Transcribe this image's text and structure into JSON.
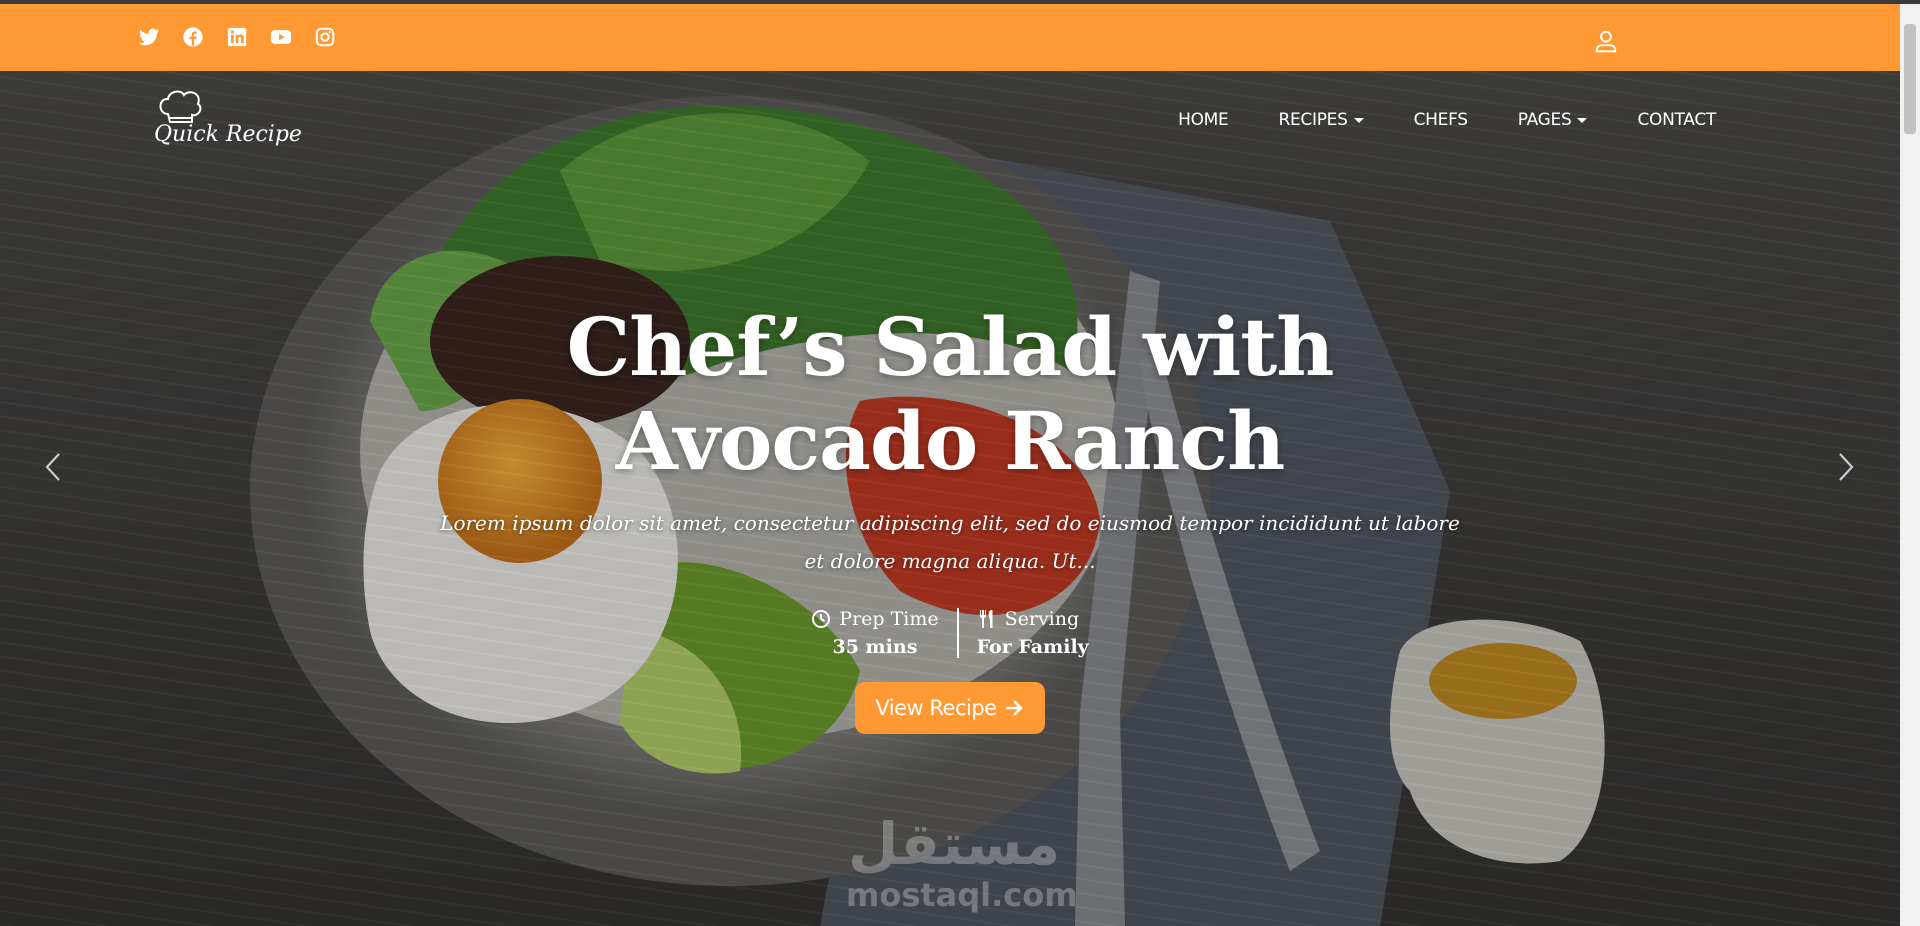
{
  "colors": {
    "accent": "#ff9933",
    "text_on_hero": "#ffffff"
  },
  "topbar": {
    "social_icons": [
      "twitter-icon",
      "facebook-icon",
      "linkedin-icon",
      "youtube-icon",
      "instagram-icon"
    ],
    "account_icon": "user-icon"
  },
  "logo": {
    "text": "Quick Recipe",
    "icon": "chef-hat-icon"
  },
  "nav": {
    "items": [
      {
        "label": "HOME",
        "dropdown": false
      },
      {
        "label": "RECIPES",
        "dropdown": true
      },
      {
        "label": "CHEFS",
        "dropdown": false
      },
      {
        "label": "PAGES",
        "dropdown": true
      },
      {
        "label": "CONTACT",
        "dropdown": false
      }
    ]
  },
  "hero": {
    "title_line1": "Chef’s Salad with",
    "title_line2": "Avocado Ranch",
    "description": "Lorem ipsum dolor sit amet, consectetur adipiscing elit, sed do eiusmod tempor incididunt ut labore et dolore magna aliqua. Ut...",
    "prep_label": "Prep Time",
    "prep_value": "35 mins",
    "serving_label": "Serving",
    "serving_value": "For Family",
    "button_label": "View Recipe",
    "prev_icon": "chevron-left-icon",
    "next_icon": "chevron-right-icon"
  },
  "watermark": {
    "arabic": "مستقل",
    "latin": "mostaql.com"
  }
}
